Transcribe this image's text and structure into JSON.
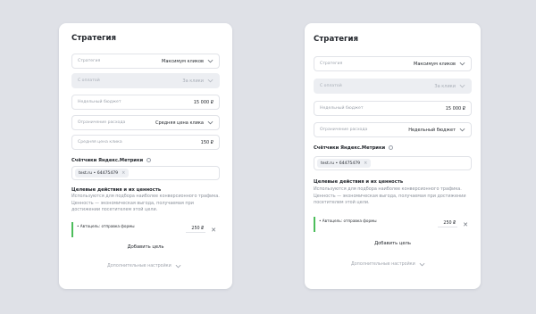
{
  "left": {
    "title": "Стратегия",
    "strategy": {
      "label": "Стратегия",
      "value": "Максимум кликов"
    },
    "payment": {
      "label": "С оплатой",
      "value": "За клики"
    },
    "weekly_budget": {
      "label": "Недельный бюджет",
      "value": "15 000 ₽"
    },
    "spend_limit": {
      "label": "Ограничение расхода",
      "value": "Средняя цена клика"
    },
    "avg_cpc": {
      "label": "Средняя цена клика",
      "value": "150 ₽"
    },
    "counters": {
      "label": "Счётчики Яндекс.Метрики",
      "chip": "test.ru • 64475479",
      "chip_close": "×"
    },
    "goals": {
      "title": "Целевые действия и их ценность",
      "description": "Используются для подбора наиболее конверсионного трафика. Ценность — экономическая выгода, получаемая при достижении посетителем этой цели.",
      "item": {
        "name": "• Автоцель: отправка формы",
        "value": "250 ₽",
        "close": "✕"
      }
    },
    "add_goal": "Добавить цель",
    "more_settings": "Дополнительные настройки"
  },
  "right": {
    "title": "Стратегия",
    "strategy": {
      "label": "Стратегия",
      "value": "Максимум кликов"
    },
    "payment": {
      "label": "С оплатой",
      "value": "За клики"
    },
    "weekly_budget": {
      "label": "Недельный бюджет",
      "value": "15 000 ₽"
    },
    "spend_limit": {
      "label": "Ограничение расхода",
      "value": "Недельный бюджет"
    },
    "counters": {
      "label": "Счётчики Яндекс.Метрики",
      "chip": "test.ru • 64475479",
      "chip_close": "×"
    },
    "goals": {
      "title": "Целевые действия и их ценность",
      "description": "Используются для подбора наиболее конверсионного трафика. Ценность — экономическая выгода, получаемая при достижении посетителем этой цели.",
      "item": {
        "name": "• Автоцель: отправка формы",
        "value": "250 ₽",
        "close": "✕"
      }
    },
    "add_goal": "Добавить цель",
    "more_settings": "Дополнительные настройки"
  },
  "icons": {
    "chevron": "chevron-down-icon",
    "info": "info-icon",
    "close": "close-icon"
  },
  "colors": {
    "background": "#dfe1e7",
    "card": "#ffffff",
    "goal_accent": "#4cbd5b",
    "disabled_field": "#eceef2"
  }
}
